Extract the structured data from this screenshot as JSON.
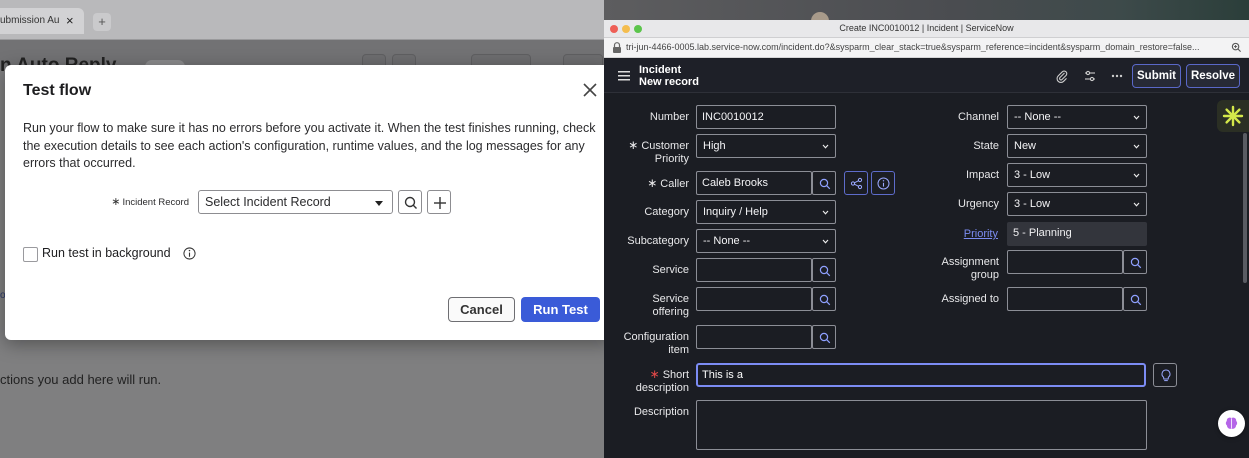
{
  "bg_app": {
    "tab_title": "ubmission Au",
    "tab_close": "×",
    "new_tab": "+",
    "page_title": "n Auto Reply",
    "footer_text": "ctions you add here will run.",
    "side_marker": "o"
  },
  "modal": {
    "title": "Test flow",
    "description": "Run your flow to make sure it has no errors before you activate it. When the test finishes running, check the execution details to see each action's configuration, runtime values, and the log messages for any errors that occurred.",
    "incident_label": "Incident Record",
    "incident_placeholder": "Select Incident Record",
    "checkbox_label": "Run test in background",
    "cancel_label": "Cancel",
    "run_label": "Run Test"
  },
  "sn": {
    "window_title": "Create INC0010012 | Incident | ServiceNow",
    "url": "tri-jun-4466-0005.lab.service-now.com/incident.do?&sysparm_clear_stack=true&sysparm_reference=incident&sysparm_domain_restore=false...",
    "record_type": "Incident",
    "record_state": "New record",
    "submit_label": "Submit",
    "resolve_label": "Resolve",
    "fields": {
      "number_label": "Number",
      "number_value": "INC0010012",
      "customer_priority_label_1": "Customer",
      "customer_priority_label_2": "Priority",
      "customer_priority_value": "High",
      "caller_label": "Caller",
      "caller_value": "Caleb Brooks",
      "category_label": "Category",
      "category_value": "Inquiry / Help",
      "subcategory_label": "Subcategory",
      "subcategory_value": "-- None --",
      "service_label": "Service",
      "service_offering_label_1": "Service",
      "service_offering_label_2": "offering",
      "config_item_label_1": "Configuration",
      "config_item_label_2": "item",
      "short_desc_label_1": "Short",
      "short_desc_label_2": "description",
      "short_desc_value": "This is a",
      "description_label": "Description",
      "channel_label": "Channel",
      "channel_value": "-- None --",
      "state_label": "State",
      "state_value": "New",
      "impact_label": "Impact",
      "impact_value": "3 - Low",
      "urgency_label": "Urgency",
      "urgency_value": "3 - Low",
      "priority_label": "Priority",
      "priority_value": "5 - Planning",
      "assignment_group_label_1": "Assignment",
      "assignment_group_label_2": "group",
      "assigned_to_label": "Assigned to"
    }
  },
  "colors": {
    "accent": "#3a5bd8",
    "sn_dark": "#1b1d23",
    "link": "#7b8cf0",
    "required": "#e04848"
  }
}
